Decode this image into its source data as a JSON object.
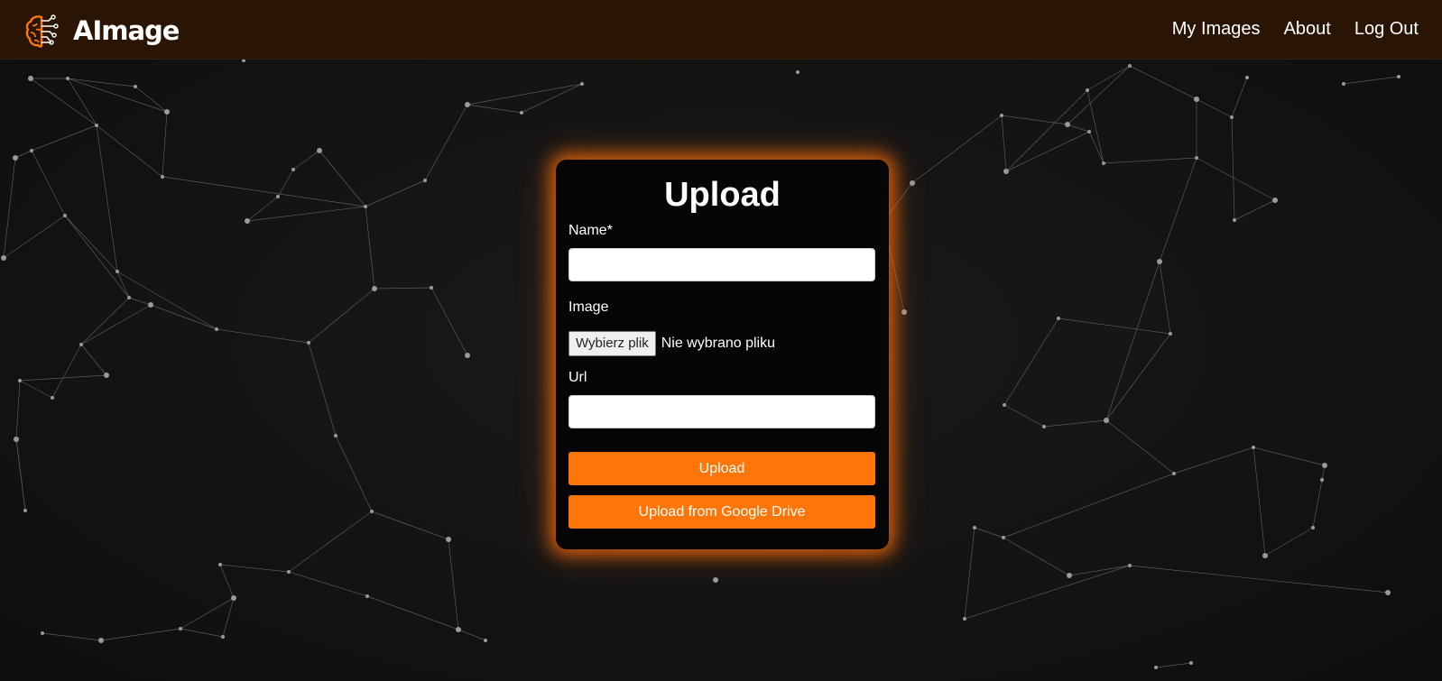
{
  "app": {
    "brand_name": "AImage",
    "logo_icon": "brain-circuit-icon",
    "accent_color": "#ff7507",
    "navbar_color": "#2a1504"
  },
  "nav": {
    "items": [
      {
        "label": "My Images"
      },
      {
        "label": "About"
      },
      {
        "label": "Log Out"
      }
    ]
  },
  "upload_form": {
    "title": "Upload",
    "name_label": "Name*",
    "name_value": "",
    "image_label": "Image",
    "file_button_label": "Wybierz plik",
    "file_status": "Nie wybrano pliku",
    "url_label": "Url",
    "url_value": "",
    "submit_label": "Upload",
    "drive_label": "Upload from Google Drive"
  },
  "background": {
    "style": "network-nodes",
    "color": "#121212"
  }
}
